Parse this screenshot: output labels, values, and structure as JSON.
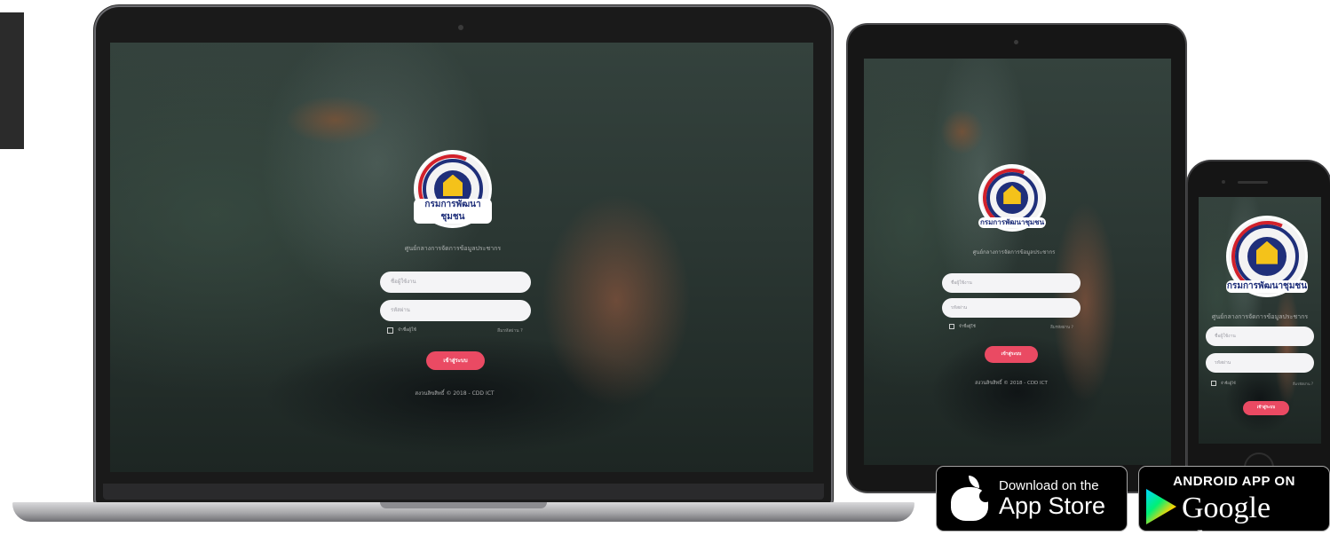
{
  "login": {
    "logo_text": "กรมการพัฒนาชุมชน",
    "subtitle": "ศูนย์กลางการจัดการข้อมูลประชากร",
    "username_placeholder": "ชื่อผู้ใช้งาน",
    "password_placeholder": "รหัสผ่าน",
    "remember_label": "จำชื่อผู้ใช้",
    "forgot_label": "ลืมรหัสผ่าน ?",
    "login_button": "เข้าสู่ระบบ",
    "copyright": "สงวนลิขสิทธิ์ © 2018 - CDD ICT"
  },
  "badges": {
    "apple_small": "Download on the",
    "apple_big": "App Store",
    "google_top": "ANDROID APP ON",
    "google_bottom": "Google play"
  },
  "colors": {
    "login_button": "#ea4a63",
    "logo_blue": "#1f2f7a",
    "logo_red": "#d2212b",
    "logo_gold": "#f4c21a"
  }
}
